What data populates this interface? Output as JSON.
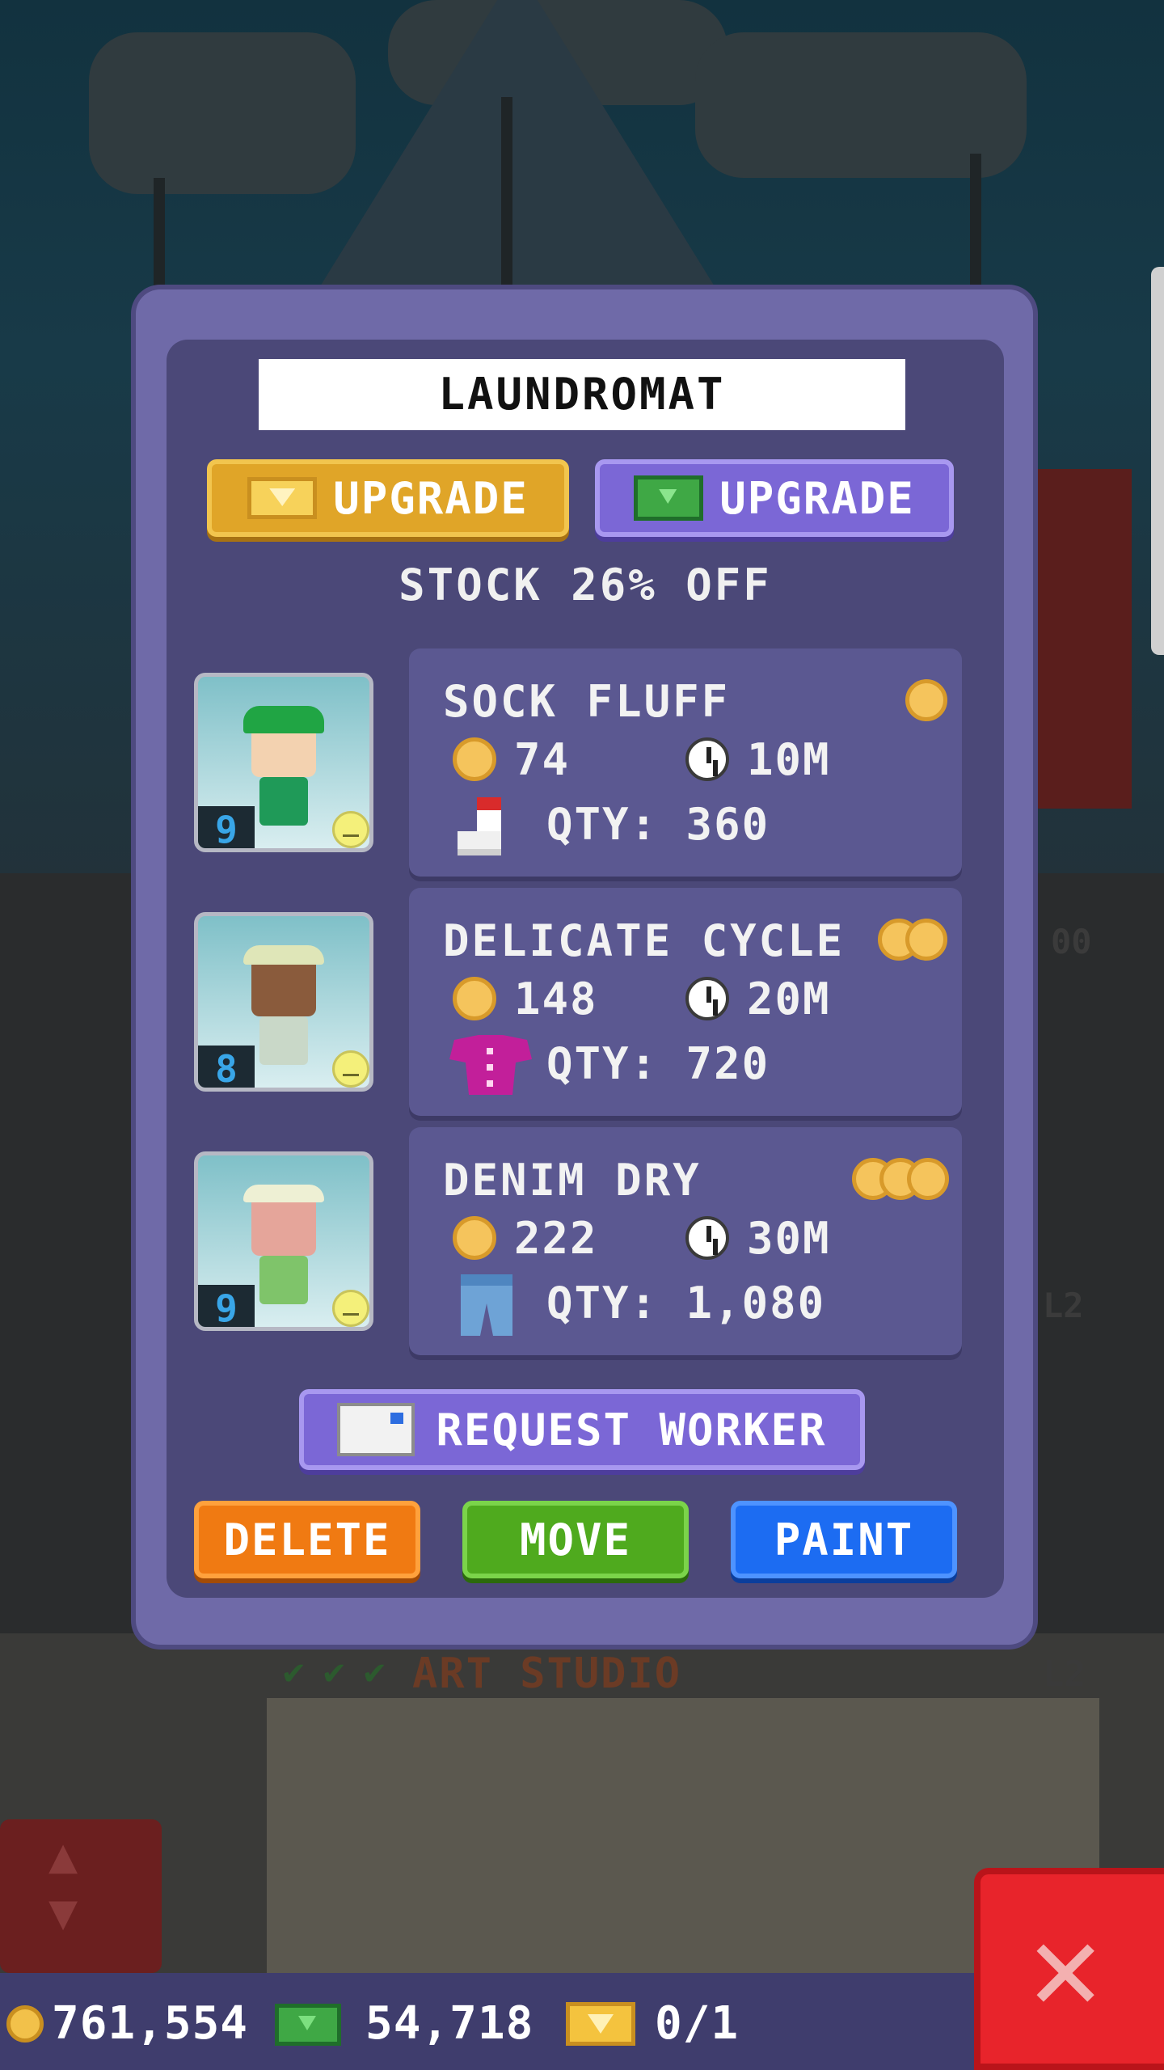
{
  "panel": {
    "title": "LAUNDROMAT",
    "upgrade_gold_label": "UPGRADE",
    "upgrade_bux_label": "UPGRADE",
    "stock_text": "STOCK 26% OFF",
    "items": [
      {
        "name": "SOCK FLUFF",
        "cost": "74",
        "time": "10M",
        "qty": "QTY: 360",
        "worker_level": "9",
        "tier": 1,
        "product_icon": "sock-icon"
      },
      {
        "name": "DELICATE CYCLE",
        "cost": "148",
        "time": "20M",
        "qty": "QTY: 720",
        "worker_level": "8",
        "tier": 2,
        "product_icon": "shirt-icon"
      },
      {
        "name": "DENIM DRY",
        "cost": "222",
        "time": "30M",
        "qty": "QTY: 1,080",
        "worker_level": "9",
        "tier": 3,
        "product_icon": "jeans-icon"
      }
    ],
    "request_worker_label": "REQUEST WORKER",
    "delete_label": "DELETE",
    "move_label": "MOVE",
    "paint_label": "PAINT"
  },
  "status_bar": {
    "coins": "761,554",
    "bux": "54,718",
    "tickets": "0/1"
  },
  "background": {
    "studio_label": "ART STUDIO",
    "studio_level": "L2",
    "side_level_1": "L2",
    "side_level_2": "00"
  },
  "colors": {
    "panel": "#6f6aa8",
    "panel_inner": "#4b4878",
    "upgrade_gold": "#e0a528",
    "upgrade_bux": "#7b67d6",
    "delete": "#f07a12",
    "move": "#4faa1e",
    "paint": "#1c6cf2",
    "close": "#e8242b"
  }
}
